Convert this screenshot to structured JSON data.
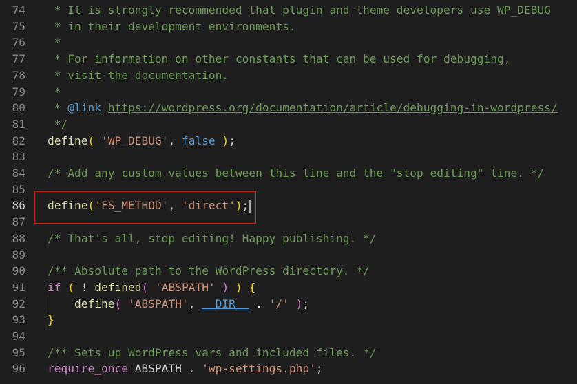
{
  "editor": {
    "lines": [
      {
        "num": "74",
        "tokens": [
          {
            "t": " * It is strongly recommended that plugin and theme developers use WP_DEBUG",
            "c": "c"
          }
        ]
      },
      {
        "num": "75",
        "tokens": [
          {
            "t": " * in their development environments.",
            "c": "c"
          }
        ]
      },
      {
        "num": "76",
        "tokens": [
          {
            "t": " *",
            "c": "c"
          }
        ]
      },
      {
        "num": "77",
        "tokens": [
          {
            "t": " * For information on other constants that can be used for debugging,",
            "c": "c"
          }
        ]
      },
      {
        "num": "78",
        "tokens": [
          {
            "t": " * visit the documentation.",
            "c": "c"
          }
        ]
      },
      {
        "num": "79",
        "tokens": [
          {
            "t": " *",
            "c": "c"
          }
        ]
      },
      {
        "num": "80",
        "tokens": [
          {
            "t": " * ",
            "c": "c"
          },
          {
            "t": "@link",
            "c": "tag"
          },
          {
            "t": " ",
            "c": "c"
          },
          {
            "t": "https://wordpress.org/documentation/article/debugging-in-wordpress/",
            "c": "link"
          }
        ]
      },
      {
        "num": "81",
        "tokens": [
          {
            "t": " */",
            "c": "c"
          }
        ]
      },
      {
        "num": "82",
        "tokens": [
          {
            "t": "define",
            "c": "fn"
          },
          {
            "t": "(",
            "c": "brk1"
          },
          {
            "t": " ",
            "c": "plain"
          },
          {
            "t": "'WP_DEBUG'",
            "c": "str"
          },
          {
            "t": ", ",
            "c": "plain"
          },
          {
            "t": "false",
            "c": "const"
          },
          {
            "t": " ",
            "c": "plain"
          },
          {
            "t": ")",
            "c": "brk1"
          },
          {
            "t": ";",
            "c": "plain"
          }
        ]
      },
      {
        "num": "83",
        "tokens": []
      },
      {
        "num": "84",
        "tokens": [
          {
            "t": "/* Add any custom values between this line and the \"stop editing\" line. */",
            "c": "c"
          }
        ]
      },
      {
        "num": "85",
        "tokens": []
      },
      {
        "num": "86",
        "active": true,
        "tokens": [
          {
            "t": "define",
            "c": "fn"
          },
          {
            "t": "(",
            "c": "brk1"
          },
          {
            "t": "'FS_METHOD'",
            "c": "str"
          },
          {
            "t": ", ",
            "c": "plain"
          },
          {
            "t": "'direct'",
            "c": "str"
          },
          {
            "t": ")",
            "c": "brk1"
          },
          {
            "t": ";",
            "c": "plain"
          }
        ]
      },
      {
        "num": "87",
        "tokens": []
      },
      {
        "num": "88",
        "tokens": [
          {
            "t": "/* That's all, stop editing! Happy publishing. */",
            "c": "c"
          }
        ]
      },
      {
        "num": "89",
        "tokens": []
      },
      {
        "num": "90",
        "tokens": [
          {
            "t": "/** Absolute path to the WordPress directory. */",
            "c": "c"
          }
        ]
      },
      {
        "num": "91",
        "tokens": [
          {
            "t": "if",
            "c": "ctl"
          },
          {
            "t": " ",
            "c": "plain"
          },
          {
            "t": "(",
            "c": "brk1"
          },
          {
            "t": " ! ",
            "c": "plain"
          },
          {
            "t": "defined",
            "c": "fn"
          },
          {
            "t": "(",
            "c": "brk2"
          },
          {
            "t": " ",
            "c": "plain"
          },
          {
            "t": "'ABSPATH'",
            "c": "str"
          },
          {
            "t": " ",
            "c": "plain"
          },
          {
            "t": ")",
            "c": "brk2"
          },
          {
            "t": " ",
            "c": "plain"
          },
          {
            "t": ")",
            "c": "brk1"
          },
          {
            "t": " ",
            "c": "plain"
          },
          {
            "t": "{",
            "c": "brk1"
          }
        ]
      },
      {
        "num": "92",
        "tokens": [
          {
            "t": "    ",
            "c": "plain"
          },
          {
            "t": "define",
            "c": "fn"
          },
          {
            "t": "(",
            "c": "brk2"
          },
          {
            "t": " ",
            "c": "plain"
          },
          {
            "t": "'ABSPATH'",
            "c": "str"
          },
          {
            "t": ", ",
            "c": "plain"
          },
          {
            "t": "__DIR__",
            "c": "magic"
          },
          {
            "t": " . ",
            "c": "plain"
          },
          {
            "t": "'/'",
            "c": "str"
          },
          {
            "t": " ",
            "c": "plain"
          },
          {
            "t": ")",
            "c": "brk2"
          },
          {
            "t": ";",
            "c": "plain"
          }
        ]
      },
      {
        "num": "93",
        "tokens": [
          {
            "t": "}",
            "c": "brk1"
          }
        ]
      },
      {
        "num": "94",
        "tokens": []
      },
      {
        "num": "95",
        "tokens": [
          {
            "t": "/** Sets up WordPress vars and included files. */",
            "c": "c"
          }
        ]
      },
      {
        "num": "96",
        "tokens": [
          {
            "t": "require_once",
            "c": "ctl"
          },
          {
            "t": " ABSPATH . ",
            "c": "plain"
          },
          {
            "t": "'wp-settings.php'",
            "c": "str"
          },
          {
            "t": ";",
            "c": "plain"
          }
        ]
      }
    ]
  }
}
